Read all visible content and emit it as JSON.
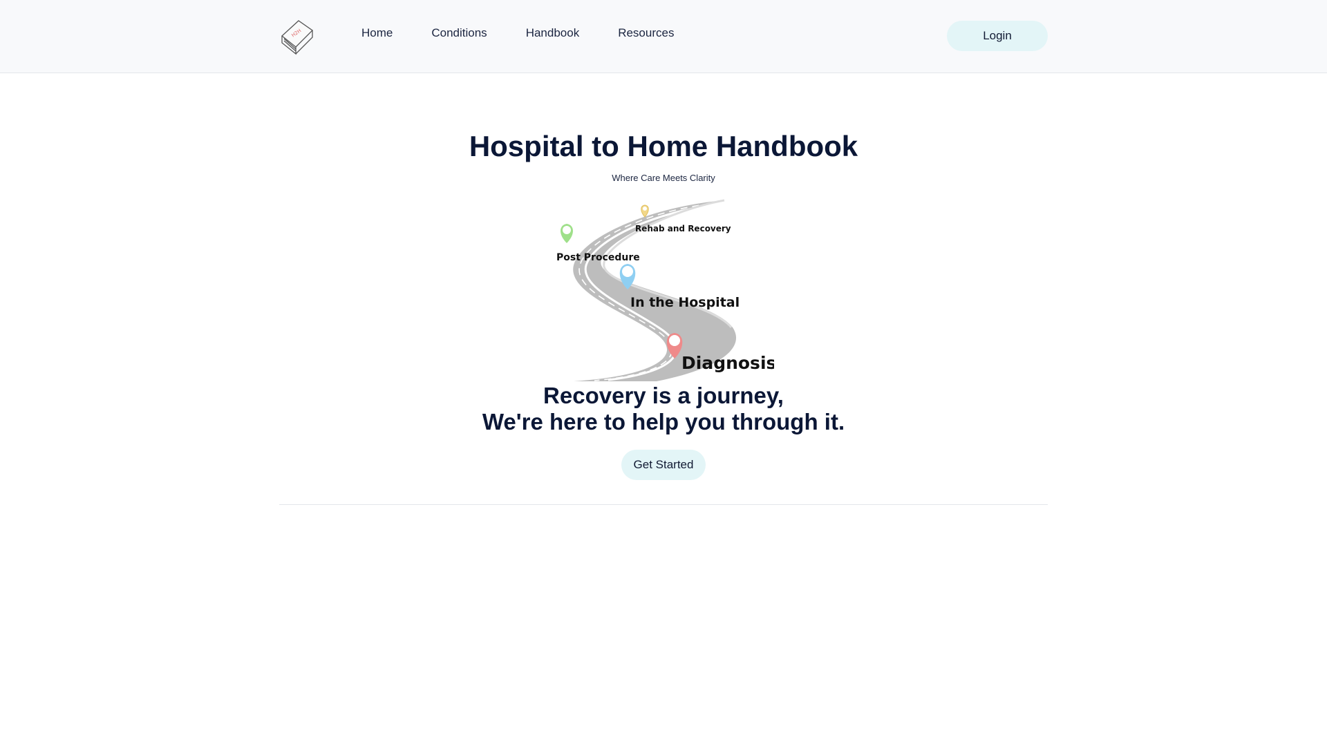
{
  "nav": {
    "logo_icon": "handbook-book-icon",
    "links": [
      "Home",
      "Conditions",
      "Handbook",
      "Resources"
    ],
    "login_label": "Login"
  },
  "hero": {
    "title": "Hospital to Home Handbook",
    "subtitle": "Where Care Meets Clarity",
    "road_stages": {
      "rehab": "Rehab and Recovery",
      "post": "Post Procedure",
      "hospital": "In the Hospital",
      "diagnosis": "Diagnosis"
    },
    "tagline_line1": "Recovery is a journey,",
    "tagline_line2": "We're here to help you through it.",
    "cta_label": "Get Started"
  },
  "colors": {
    "accent_button": "#e3f5f7",
    "title": "#0b1736",
    "pin_rehab": "#f2d88a",
    "pin_post": "#9fe08a",
    "pin_hospital": "#8fcff2",
    "pin_diagnosis": "#ef8a8a",
    "road": "#bdbdbd"
  }
}
